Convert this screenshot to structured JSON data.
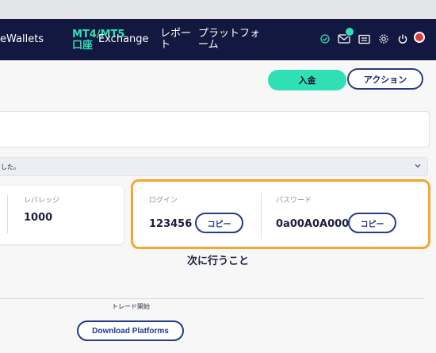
{
  "nav": {
    "items": [
      {
        "label": "eWallets"
      },
      {
        "label_top": "MT4/MT5",
        "label_bottom": "口座",
        "active": true
      },
      {
        "label": "Exchange"
      },
      {
        "label_top": "レポー",
        "label_bottom": "ト"
      },
      {
        "label_top": "プラットフォ",
        "label_bottom": "ーム"
      }
    ],
    "icons": [
      "check-circle-icon",
      "mail-icon",
      "id-card-icon",
      "gear-icon",
      "power-icon",
      "status-dot-icon"
    ],
    "colors": {
      "navbar": "#131840",
      "accent": "#2fe0b4",
      "status_dot": "#e23a3a"
    }
  },
  "actions": {
    "deposit_label": "入金",
    "action_label": "アクション"
  },
  "info": {
    "message": "した。"
  },
  "leverage": {
    "label": "レバレッジ",
    "value": "1000"
  },
  "credentials": {
    "login_label": "ログイン",
    "login_value": "123456",
    "password_label": "パスワード",
    "password_value": "0a00A0A000",
    "copy_label": "コピー",
    "highlight_color": "#f7a531"
  },
  "next": {
    "title": "次に行うこと",
    "trade_start": "トレード開始",
    "download_label": "Download Platforms"
  }
}
